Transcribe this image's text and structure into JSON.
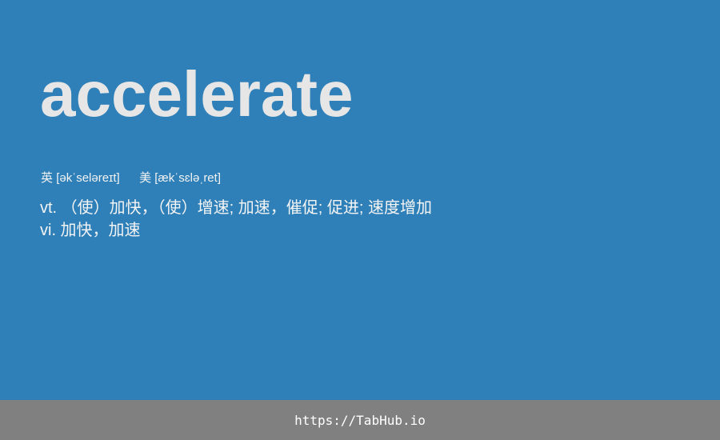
{
  "word": "accelerate",
  "phonetics": {
    "uk_label": "英",
    "uk_ipa": "[əkˈseləreɪt]",
    "us_label": "美",
    "us_ipa": "[ækˈsɛləˌret]"
  },
  "definitions": [
    "vt. （使）加快，（使）增速; 加速，催促; 促进; 速度增加",
    "vi. 加快，加速"
  ],
  "footer": {
    "url": "https://TabHub.io"
  },
  "colors": {
    "background": "#2f80b8",
    "word": "#e6e6e6",
    "footer_bar": "#808080"
  }
}
